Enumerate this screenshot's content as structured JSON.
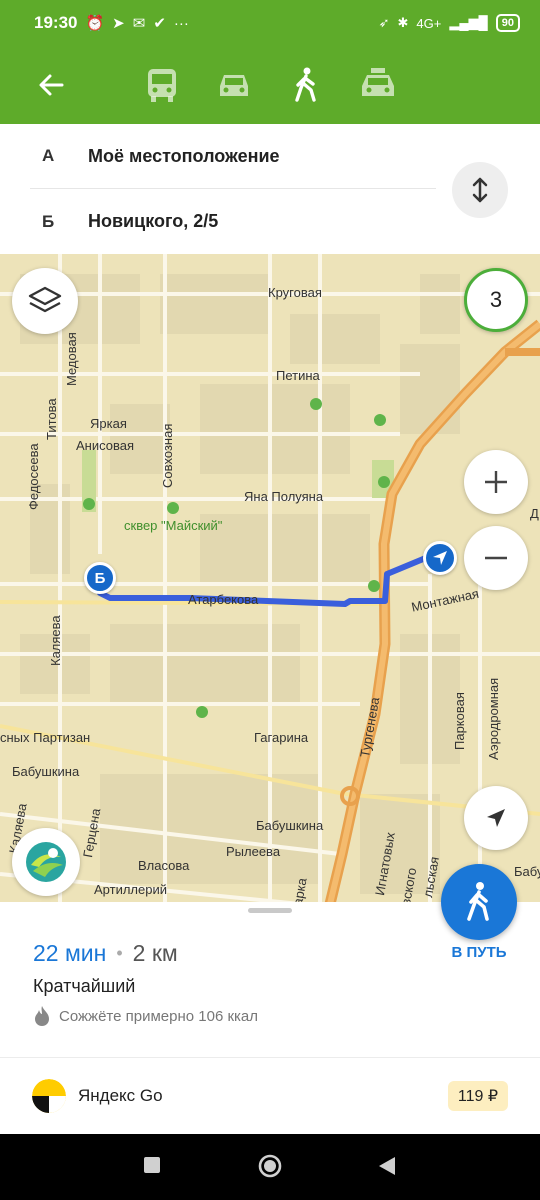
{
  "status_bar": {
    "time": "19:30",
    "network": "4G+",
    "battery": "90"
  },
  "topbar": {
    "modes": [
      "bus-icon",
      "car-icon",
      "pedestrian-icon",
      "taxi-icon"
    ],
    "active_mode": "pedestrian-icon"
  },
  "route_points": {
    "a": {
      "letter": "А",
      "text": "Моё местоположение"
    },
    "b": {
      "letter": "Б",
      "text": "Новицкого, 2/5"
    }
  },
  "map": {
    "traffic_level": "3",
    "pin_b_letter": "Б",
    "labels": {
      "krugovaya": "Круговая",
      "petina": "Петина",
      "medovaya": "Медовая",
      "titova": "Титова",
      "fedoseeva": "Федосеева",
      "yarkaya": "Яркая",
      "anisovaya": "Анисовая",
      "sovkhoznaya": "Совхозная",
      "yana_poluyana": "Яна Полуяна",
      "skver": "сквер \"Майский\"",
      "atarbekova": "Атарбекова",
      "montazhnaya": "Монтажная",
      "kalyaeva": "Каляева",
      "partizan": "сных Партизан",
      "gagarina": "Гагарина",
      "babushkina_left": "Бабушкина",
      "babushkina_mid": "Бабушкина",
      "turgeneva": "Тургенева",
      "parkovaya": "Парковая",
      "aerodromnaya": "Аэродромная",
      "kalyaeva2": "Каляева",
      "gertsena": "Герцена",
      "ryleeva": "Рылеева",
      "vlasova": "Власова",
      "artilleriy": "Артиллерий",
      "ignatovykh": "Игнатовых",
      "arka": "арка",
      "vskogo": "вского",
      "lskaya": "льская",
      "babu": "Бабу",
      "d": "Д"
    }
  },
  "panel": {
    "go_label": "В ПУТЬ",
    "time": "22 мин",
    "separator": "•",
    "distance": "2 км",
    "route_type": "Кратчайший",
    "calories": "Сожжёте примерно 106 ккал",
    "taxi_name": "Яндекс Go",
    "taxi_price": "119 ₽"
  },
  "colors": {
    "accent_green": "#5eab2a",
    "route_blue": "#3a5fdc",
    "primary_blue": "#1a77d7",
    "map_bg": "#ede3b9"
  }
}
